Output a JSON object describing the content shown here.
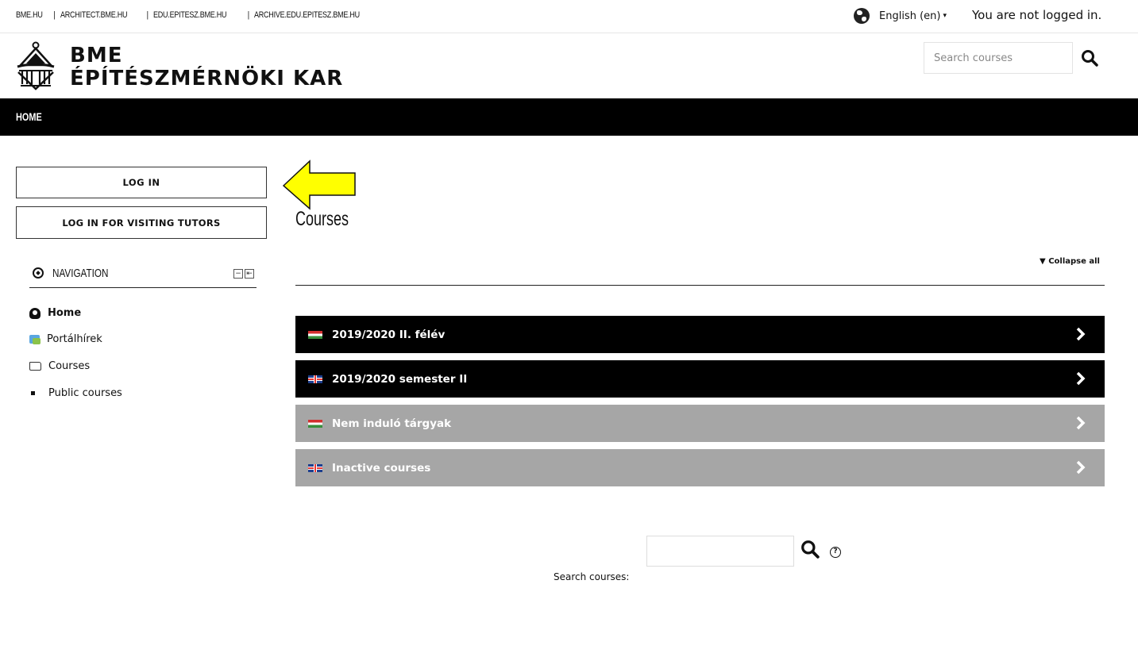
{
  "top_links": [
    "BME.HU",
    "ARCHITECT.BME.HU",
    "EDU.EPITESZ.BME.HU",
    "ARCHIVE.EDU.EPITESZ.BME.HU"
  ],
  "top_links_separator": "|",
  "language": {
    "label": "English (en)",
    "caret": "▾",
    "icon": "globe-icon"
  },
  "login_status": "You are not logged in.",
  "brand": {
    "line1": "BME",
    "line2": "ÉPÍTÉSZMÉRNÖKI KAR",
    "logo_icon": "faculty-emblem-icon"
  },
  "header_search": {
    "placeholder": "Search courses",
    "icon": "search-icon"
  },
  "navbar": {
    "home": "HOME"
  },
  "sidebar": {
    "login_button": "LOG IN",
    "visiting_button": "LOG IN FOR VISITING TUTORS",
    "navigation": {
      "title": "NAVIGATION",
      "icon": "compass-icon",
      "dock_icons": [
        "−",
        "⇤"
      ],
      "items": [
        {
          "label": "Home",
          "icon": "dashboard-icon"
        },
        {
          "label": "Portálhírek",
          "icon": "forum-icon"
        },
        {
          "label": "Courses",
          "icon": "folder-icon"
        },
        {
          "label": "Public courses",
          "icon": "bullet-icon"
        }
      ]
    }
  },
  "main": {
    "title": "Courses",
    "collapse_all": "Collapse all",
    "collapse_icon": "▼",
    "categories": [
      {
        "label": "2019/2020 II. félév",
        "flag": "hu-flag-icon",
        "style": "dark",
        "color": "#000000"
      },
      {
        "label": "2019/2020 semester II",
        "flag": "uk-flag-icon",
        "style": "dark",
        "color": "#000000"
      },
      {
        "label": "Nem induló tárgyak",
        "flag": "hu-flag-icon",
        "style": "grey",
        "color": "#a6a6a6"
      },
      {
        "label": "Inactive courses",
        "flag": "uk-flag-icon",
        "style": "grey",
        "color": "#a6a6a6"
      }
    ],
    "bottom_search": {
      "label": "Search courses:",
      "value": "",
      "help": "?"
    }
  },
  "annotation_arrow": {
    "color": "#ffff00",
    "points_to": "LOG IN"
  }
}
